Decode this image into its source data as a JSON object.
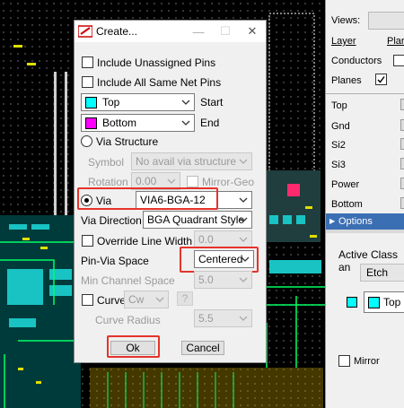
{
  "dialog": {
    "title": "Create...",
    "include_unassigned": "Include Unassigned Pins",
    "include_same_net": "Include All Same Net Pins",
    "start_layer": "Top",
    "start_label": "Start",
    "end_layer": "Bottom",
    "end_label": "End",
    "via_structure": "Via Structure",
    "symbol_label": "Symbol",
    "symbol_value": "No avail via structure",
    "rotation_label": "Rotation",
    "rotation_value": "0.00",
    "mirror_geo": "Mirror-Geo",
    "via_label": "Via",
    "via_value": "VIA6-BGA-12",
    "via_direction_label": "Via Direction",
    "via_direction_value": "BGA Quadrant Style",
    "override_line_width": "Override Line Width",
    "override_value": "0.0",
    "pin_via_space_label": "Pin-Via Space",
    "pin_via_space_value": "Centered",
    "min_channel_label": "Min Channel Space",
    "min_channel_value": "5.0",
    "curve_label": "Curve",
    "curve_value": "Cw",
    "help_label": "?",
    "curve_radius_label": "Curve Radius",
    "curve_radius_value": "5.5",
    "ok": "Ok",
    "cancel": "Cancel"
  },
  "right_panel": {
    "views": "Views:",
    "layer": "Layer",
    "plan": "Plar",
    "conductors": "Conductors",
    "planes": "Planes",
    "layers": [
      "Top",
      "Gnd",
      "Si2",
      "Si3",
      "Power",
      "Bottom"
    ],
    "options_header": "Options",
    "active_class": "Active Class an",
    "etch": "Etch",
    "top_layer": "Top",
    "mirror": "Mirror"
  },
  "colors": {
    "top": "#00ffff",
    "bottom": "#ff00ff",
    "highlight": "#e6332a"
  }
}
